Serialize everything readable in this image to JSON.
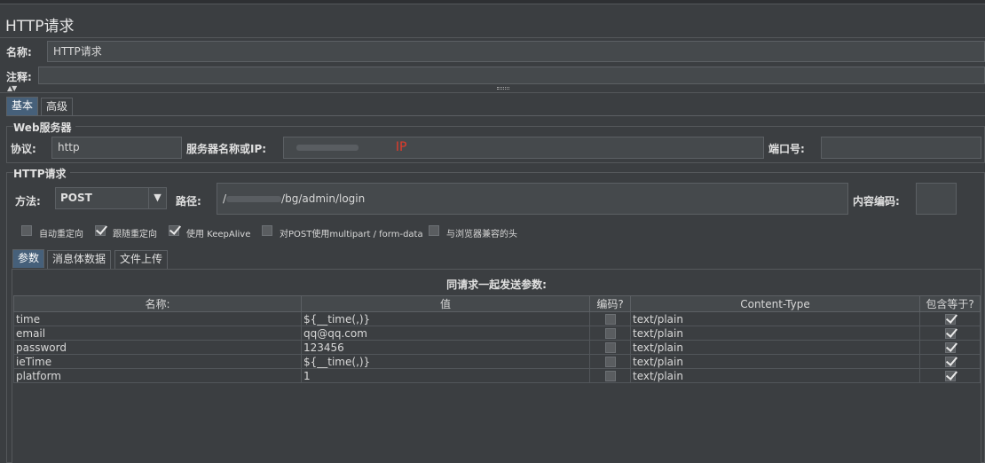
{
  "title": "HTTP请求",
  "name_label": "名称:",
  "name_value": "HTTP请求",
  "comment_label": "注释:",
  "comment_value": "",
  "main_tabs": [
    "基本",
    "高级"
  ],
  "web_server": {
    "group_title": "Web服务器",
    "protocol_label": "协议:",
    "protocol_value": "http",
    "server_label": "服务器名称或IP:",
    "server_value": "IP",
    "port_label": "端口号:",
    "port_value": ""
  },
  "http_request": {
    "group_title": "HTTP请求",
    "method_label": "方法:",
    "method_value": "POST",
    "path_label": "路径:",
    "path_prefix": "/",
    "path_value": "/bg/admin/login",
    "encoding_label": "内容编码:",
    "encoding_value": ""
  },
  "options": [
    {
      "label": "自动重定向",
      "checked": false
    },
    {
      "label": "跟随重定向",
      "checked": true
    },
    {
      "label": "使用 KeepAlive",
      "checked": true
    },
    {
      "label": "对POST使用multipart / form-data",
      "checked": false
    },
    {
      "label": "与浏览器兼容的头",
      "checked": false
    }
  ],
  "sub_tabs": [
    "参数",
    "消息体数据",
    "文件上传"
  ],
  "params_table": {
    "caption": "同请求一起发送参数:",
    "headers": [
      "名称:",
      "值",
      "编码?",
      "Content-Type",
      "包含等于?"
    ],
    "rows": [
      {
        "name": "time",
        "value": "${__time(,)}",
        "encode": false,
        "content_type": "text/plain",
        "include_equals": true
      },
      {
        "name": "email",
        "value": "qq@qq.com",
        "encode": false,
        "content_type": "text/plain",
        "include_equals": true
      },
      {
        "name": "password",
        "value": "123456",
        "encode": false,
        "content_type": "text/plain",
        "include_equals": true
      },
      {
        "name": "ieTime",
        "value": "${__time(,)}",
        "encode": false,
        "content_type": "text/plain",
        "include_equals": true
      },
      {
        "name": "platform",
        "value": "1",
        "encode": false,
        "content_type": "text/plain",
        "include_equals": true
      }
    ]
  }
}
